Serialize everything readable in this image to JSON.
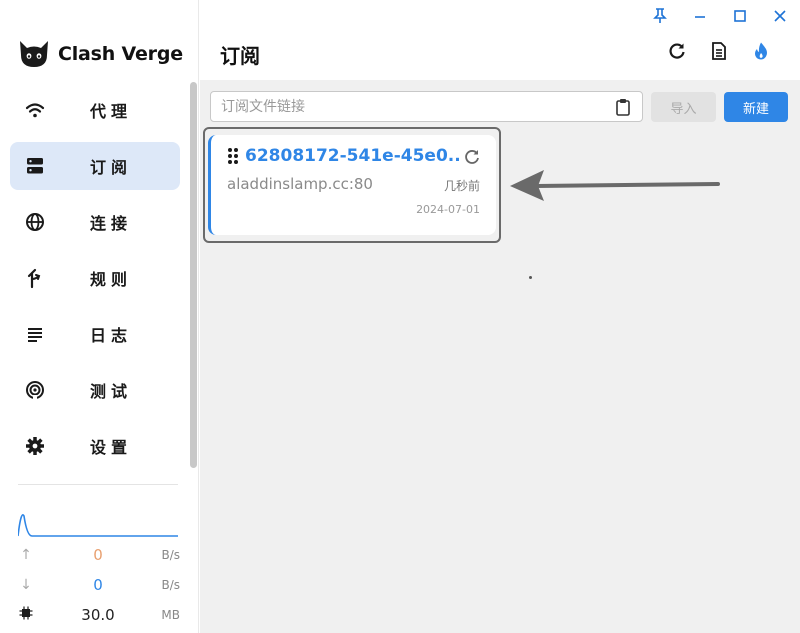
{
  "app": {
    "name": "Clash Verge"
  },
  "window": {
    "pin": "pin-icon",
    "minimize": "minimize-icon",
    "maximize": "maximize-icon",
    "close": "close-icon"
  },
  "sidebar": {
    "items": [
      {
        "label": "代理",
        "icon": "wifi-icon",
        "active": false
      },
      {
        "label": "订阅",
        "icon": "dns-icon",
        "active": true
      },
      {
        "label": "连接",
        "icon": "globe-icon",
        "active": false
      },
      {
        "label": "规则",
        "icon": "fork-icon",
        "active": false
      },
      {
        "label": "日志",
        "icon": "lines-icon",
        "active": false
      },
      {
        "label": "测试",
        "icon": "radar-icon",
        "active": false
      },
      {
        "label": "设置",
        "icon": "gear-icon",
        "active": false
      }
    ]
  },
  "traffic": {
    "upload": {
      "value": "0",
      "unit": "B/s",
      "color": "#e8a070"
    },
    "download": {
      "value": "0",
      "unit": "B/s",
      "color": "#2f86e6"
    },
    "memory": {
      "value": "30.0",
      "unit": "MB"
    }
  },
  "header": {
    "title": "订阅"
  },
  "toolbar": {
    "url_placeholder": "订阅文件链接",
    "import_label": "导入",
    "new_label": "新建"
  },
  "profile": {
    "name": "62808172-541e-45e0...",
    "host": "aladdinslamp.cc:80",
    "updated": "几秒前",
    "date": "2024-07-01"
  },
  "colors": {
    "accent": "#2f86e6",
    "active_bg": "#dde8f8",
    "main_bg": "#f0f0f0"
  }
}
